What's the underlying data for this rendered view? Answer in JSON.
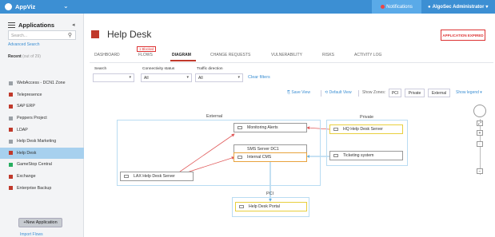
{
  "topbar": {
    "app_name": "AppViz",
    "notifications_label": "Notifications",
    "user_label": "AlgoSec Administrator"
  },
  "sidebar": {
    "title": "Applications",
    "search_placeholder": "Search...",
    "advanced_search": "Advanced Search",
    "recent_label": "Recent",
    "recent_count": "(out of 29)",
    "items": [
      {
        "label": "WebAccess - DCN1 Zone",
        "color": "#9aa0a6"
      },
      {
        "label": "Telepresence",
        "color": "#c0392b"
      },
      {
        "label": "SAP ERP",
        "color": "#c0392b"
      },
      {
        "label": "Peppers Project",
        "color": "#9aa0a6"
      },
      {
        "label": "LDAP",
        "color": "#c0392b"
      },
      {
        "label": "Help Desk Marketing",
        "color": "#9aa0a6"
      },
      {
        "label": "Help Desk",
        "color": "#c0392b",
        "active": true
      },
      {
        "label": "GameStop Central",
        "color": "#27ae60"
      },
      {
        "label": "Exchange",
        "color": "#c0392b"
      },
      {
        "label": "Enterprise Backup",
        "color": "#c0392b"
      }
    ],
    "new_application": "+New Application",
    "import_flows": "Import Flows"
  },
  "page": {
    "title": "Help Desk",
    "status_badge": "APPLICATION EXPIRED",
    "blocked_badge": "1 Blocked"
  },
  "tabs": [
    "DASHBOARD",
    "FLOWS",
    "DIAGRAM",
    "CHANGE REQUESTS",
    "VULNERABILITY",
    "RISKS",
    "ACTIVITY LOG"
  ],
  "active_tab": "DIAGRAM",
  "filters": {
    "search_label": "Search",
    "connectivity_label": "Connectivity status",
    "connectivity_value": "All",
    "traffic_label": "Traffic direction",
    "traffic_value": "All",
    "clear": "Clear filters"
  },
  "toolbar": {
    "save_view": "Save View",
    "default_view": "Default View",
    "show_zones": "Show Zones:",
    "zone_pci": "PCI",
    "zone_private": "Private",
    "zone_external": "External",
    "show_legend": "Show legend"
  },
  "diagram": {
    "zones": {
      "external": "External",
      "private": "Private",
      "pci": "PCI"
    },
    "nodes": {
      "monitoring": "Monitoring Alerts",
      "sms": "SMS Server DC1",
      "internal_cms": "Internal CMS",
      "lax": "LAX Help Desk Server",
      "hq": "HQ Help Desk Server",
      "ticketing": "Ticketing system",
      "portal": "Help Desk Portal"
    },
    "colors": {
      "red_edge": "#e05a5a",
      "blue_edge": "#6ab0e0",
      "highlight": "#e8a33d"
    }
  }
}
